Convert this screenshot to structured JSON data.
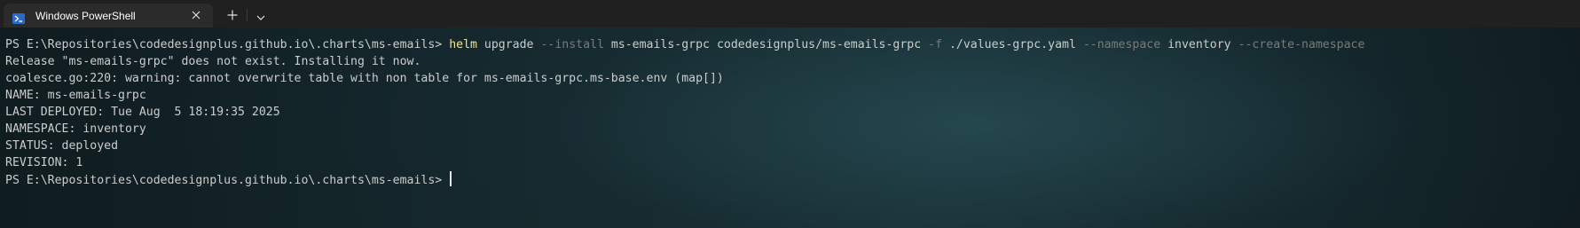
{
  "tab": {
    "title": "Windows PowerShell",
    "icon": "powershell-icon",
    "close_icon": "close-icon"
  },
  "toolbar": {
    "new_tab_icon": "plus-icon",
    "dropdown_icon": "chevron-down-icon"
  },
  "colors": {
    "command": "#f2e58a",
    "parameter": "#7a7a7a",
    "text": "#cccccc",
    "tabbar": "#202020"
  },
  "terminal": {
    "prompt": "PS E:\\Repositories\\codedesignplus.github.io\\.charts\\ms-emails> ",
    "command": {
      "program": "helm",
      "t1": " upgrade ",
      "p1": "--install",
      "t2": " ms-emails-grpc codedesignplus/ms-emails-grpc ",
      "p2": "-f",
      "t3": " ./values-grpc.yaml ",
      "p3": "--namespace",
      "t4": " inventory ",
      "p4": "--create-namespace"
    },
    "output": [
      "Release \"ms-emails-grpc\" does not exist. Installing it now.",
      "coalesce.go:220: warning: cannot overwrite table with non table for ms-emails-grpc.ms-base.env (map[])",
      "NAME: ms-emails-grpc",
      "LAST DEPLOYED: Tue Aug  5 18:19:35 2025",
      "NAMESPACE: inventory",
      "STATUS: deployed",
      "REVISION: 1"
    ],
    "final_prompt": "PS E:\\Repositories\\codedesignplus.github.io\\.charts\\ms-emails>"
  }
}
